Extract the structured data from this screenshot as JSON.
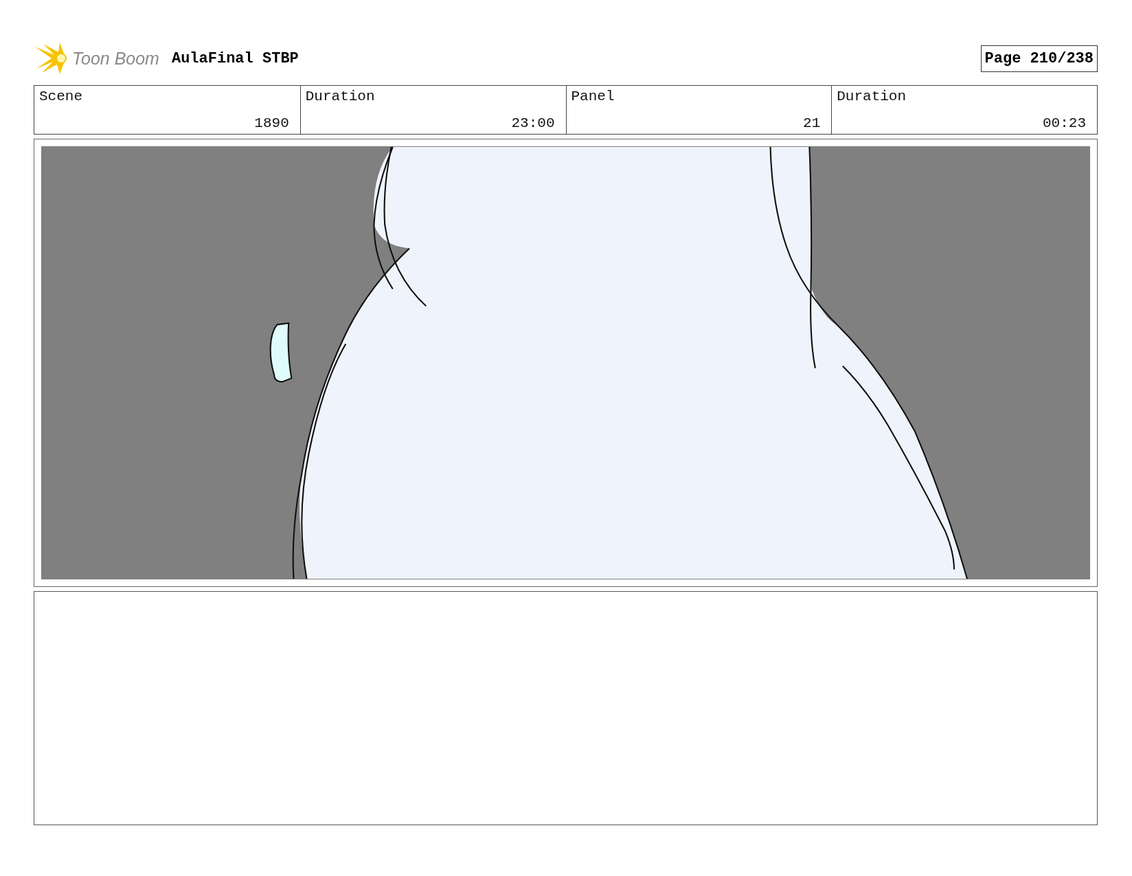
{
  "header": {
    "logo_text": "Toon Boom",
    "title": "AulaFinal STBP",
    "page": "Page 210/238"
  },
  "info": [
    {
      "label": "Scene",
      "value": "1890"
    },
    {
      "label": "Duration",
      "value": "23:00"
    },
    {
      "label": "Panel",
      "value": "21"
    },
    {
      "label": "Duration",
      "value": "00:23"
    }
  ]
}
